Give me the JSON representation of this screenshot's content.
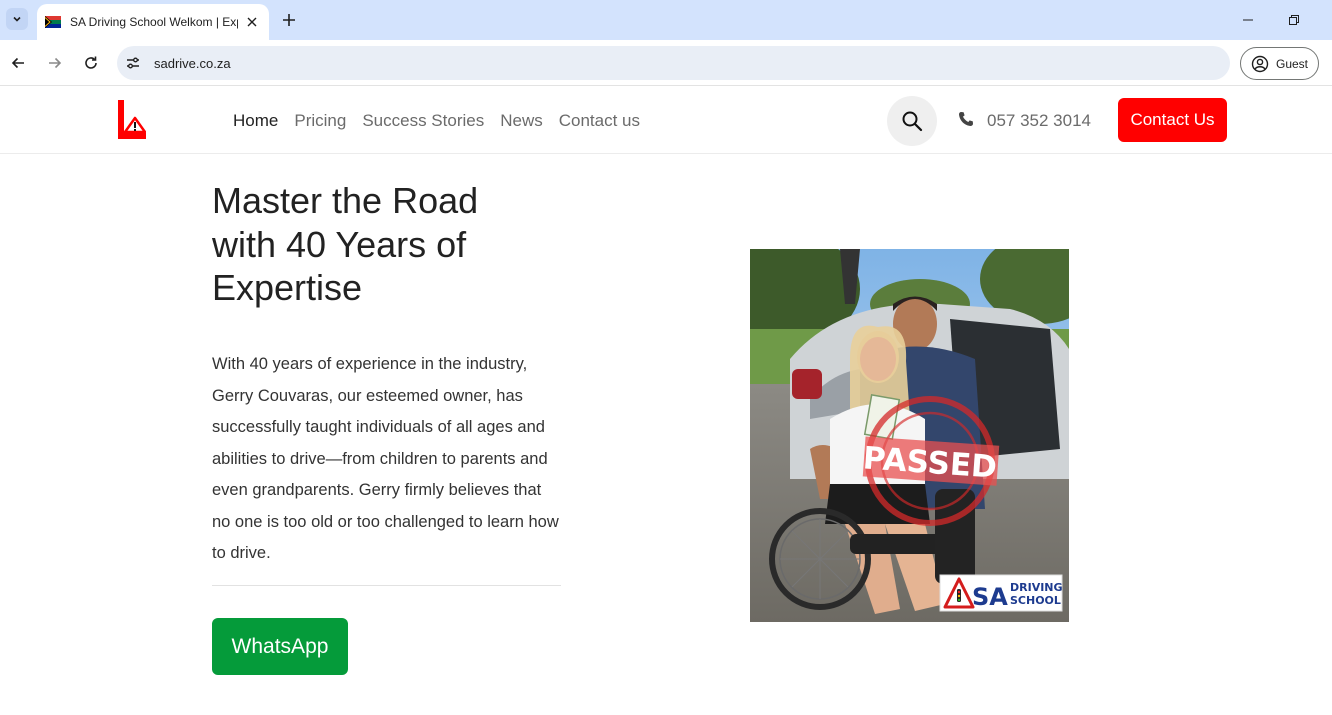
{
  "browser": {
    "tab": {
      "title": "SA Driving School Welkom | Expertise"
    },
    "url": "sadrive.co.za",
    "profile_label": "Guest",
    "icons": [
      "tab-list-icon",
      "favicon-sa-flag",
      "close-icon",
      "plus-icon",
      "minimize-icon",
      "restore-icon",
      "back-arrow-icon",
      "forward-arrow-icon",
      "reload-icon",
      "site-info-icon",
      "profile-icon"
    ]
  },
  "header": {
    "nav": [
      {
        "label": "Home",
        "active": true
      },
      {
        "label": "Pricing",
        "active": false
      },
      {
        "label": "Success Stories",
        "active": false
      },
      {
        "label": "News",
        "active": false
      },
      {
        "label": "Contact us",
        "active": false
      }
    ],
    "phone": "057 352 3014",
    "cta_label": "Contact Us"
  },
  "hero": {
    "title_lines": [
      "Master the Road",
      "with 40 Years of",
      "Expertise"
    ],
    "paragraph": "With 40 years of experience in the industry, Gerry Couvaras, our esteemed owner, has successfully taught individuals of all ages and abilities to drive—from children to parents and even grandparents. Gerry firmly believes that no one is too old or too challenged to learn how to drive.",
    "whatsapp_label": "WhatsApp",
    "photo": {
      "stamp_text": "PASSED",
      "badge_line1": "DRIVING",
      "badge_line2": "SCHOOL",
      "badge_prefix": "SA"
    }
  },
  "colors": {
    "brand_red": "#ff0000",
    "whatsapp_green": "#059b3a",
    "chrome_tabbar": "#d3e3fd",
    "omnibox": "#e9eef6"
  }
}
